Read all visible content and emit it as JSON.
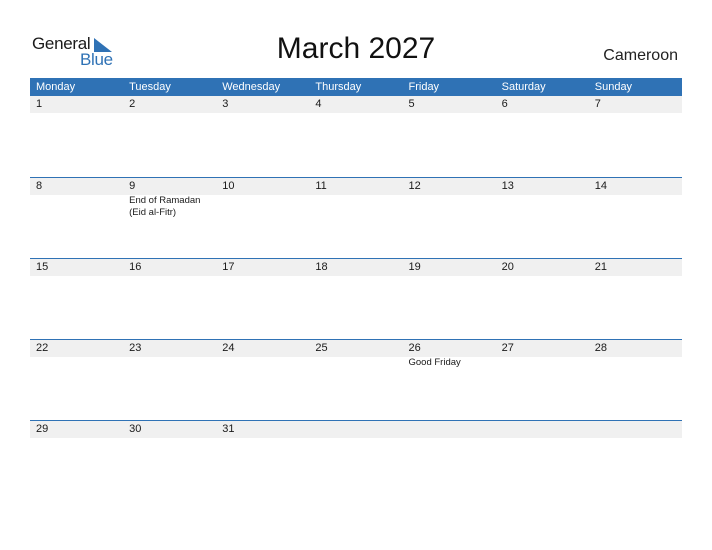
{
  "logo": {
    "general": "General",
    "blue": "Blue",
    "icon": "triangle-flag-icon"
  },
  "title": "March 2027",
  "country": "Cameroon",
  "colors": {
    "accent": "#2f72b5",
    "band": "#f0f0f0"
  },
  "weekdays": [
    "Monday",
    "Tuesday",
    "Wednesday",
    "Thursday",
    "Friday",
    "Saturday",
    "Sunday"
  ],
  "weeks": [
    [
      {
        "day": "1",
        "event": ""
      },
      {
        "day": "2",
        "event": ""
      },
      {
        "day": "3",
        "event": ""
      },
      {
        "day": "4",
        "event": ""
      },
      {
        "day": "5",
        "event": ""
      },
      {
        "day": "6",
        "event": ""
      },
      {
        "day": "7",
        "event": ""
      }
    ],
    [
      {
        "day": "8",
        "event": ""
      },
      {
        "day": "9",
        "event": "End of Ramadan (Eid al-Fitr)"
      },
      {
        "day": "10",
        "event": ""
      },
      {
        "day": "11",
        "event": ""
      },
      {
        "day": "12",
        "event": ""
      },
      {
        "day": "13",
        "event": ""
      },
      {
        "day": "14",
        "event": ""
      }
    ],
    [
      {
        "day": "15",
        "event": ""
      },
      {
        "day": "16",
        "event": ""
      },
      {
        "day": "17",
        "event": ""
      },
      {
        "day": "18",
        "event": ""
      },
      {
        "day": "19",
        "event": ""
      },
      {
        "day": "20",
        "event": ""
      },
      {
        "day": "21",
        "event": ""
      }
    ],
    [
      {
        "day": "22",
        "event": ""
      },
      {
        "day": "23",
        "event": ""
      },
      {
        "day": "24",
        "event": ""
      },
      {
        "day": "25",
        "event": ""
      },
      {
        "day": "26",
        "event": "Good Friday"
      },
      {
        "day": "27",
        "event": ""
      },
      {
        "day": "28",
        "event": ""
      }
    ],
    [
      {
        "day": "29",
        "event": ""
      },
      {
        "day": "30",
        "event": ""
      },
      {
        "day": "31",
        "event": ""
      },
      {
        "day": "",
        "event": ""
      },
      {
        "day": "",
        "event": ""
      },
      {
        "day": "",
        "event": ""
      },
      {
        "day": "",
        "event": ""
      }
    ]
  ]
}
